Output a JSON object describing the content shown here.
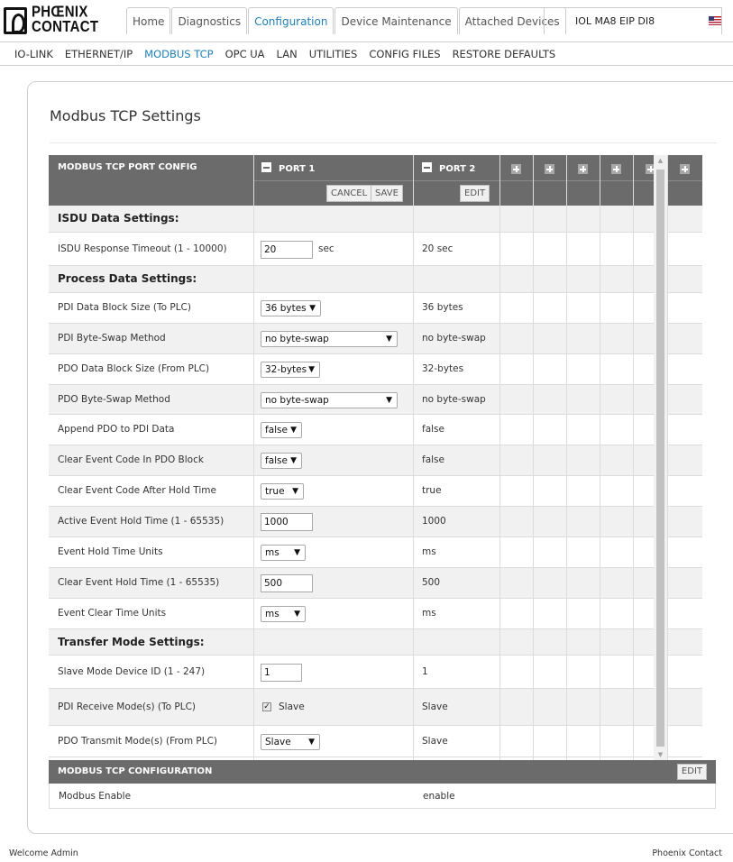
{
  "brand": {
    "line1": "PHŒNIX",
    "line2": "CONTACT"
  },
  "tabs": [
    {
      "label": "Home"
    },
    {
      "label": "Diagnostics"
    },
    {
      "label": "Configuration"
    },
    {
      "label": "Device Maintenance"
    },
    {
      "label": "Attached Devices"
    }
  ],
  "active_tab": "Configuration",
  "device_name": "IOL MA8 EIP DI8",
  "subnav": [
    "IO-LINK",
    "ETHERNET/IP",
    "MODBUS TCP",
    "OPC UA",
    "LAN",
    "UTILITIES",
    "CONFIG FILES",
    "RESTORE DEFAULTS"
  ],
  "active_subnav": "MODBUS TCP",
  "page_title": "Modbus TCP Settings",
  "port_table": {
    "header": "MODBUS TCP PORT CONFIG",
    "port1_label": "PORT 1",
    "port2_label": "PORT 2",
    "cancel_label": "CANCEL",
    "save_label": "SAVE",
    "edit_label": "EDIT",
    "rows": [
      {
        "type": "section",
        "label": "ISDU Data Settings:"
      },
      {
        "type": "input",
        "label": "ISDU Response Timeout (1 - 10000)",
        "port1": "20",
        "unit": "sec",
        "port2": "20 sec"
      },
      {
        "type": "section",
        "label": "Process Data Settings:"
      },
      {
        "type": "select",
        "label": "PDI Data Block Size (To PLC)",
        "port1": "36 bytes",
        "port2": "36 bytes"
      },
      {
        "type": "select",
        "label": "PDI Byte-Swap Method",
        "port1": "no byte-swap",
        "port2": "no byte-swap"
      },
      {
        "type": "select",
        "label": "PDO Data Block Size (From PLC)",
        "port1": "32-bytes",
        "port2": "32-bytes"
      },
      {
        "type": "select",
        "label": "PDO Byte-Swap Method",
        "port1": "no byte-swap",
        "port2": "no byte-swap"
      },
      {
        "type": "select",
        "label": "Append PDO to PDI Data",
        "port1": "false",
        "port2": "false"
      },
      {
        "type": "select",
        "label": "Clear Event Code In PDO Block",
        "port1": "false",
        "port2": "false"
      },
      {
        "type": "select",
        "label": "Clear Event Code After Hold Time",
        "port1": "true",
        "port2": "true"
      },
      {
        "type": "input",
        "label": "Active Event Hold Time (1 - 65535)",
        "port1": "1000",
        "port2": "1000"
      },
      {
        "type": "select",
        "label": "Event Hold Time Units",
        "port1": "ms",
        "port2": "ms"
      },
      {
        "type": "input",
        "label": "Clear Event Hold Time (1 - 65535)",
        "port1": "500",
        "port2": "500"
      },
      {
        "type": "select",
        "label": "Event Clear Time Units",
        "port1": "ms",
        "port2": "ms"
      },
      {
        "type": "section",
        "label": "Transfer Mode Settings:"
      },
      {
        "type": "input",
        "label": "Slave Mode Device ID (1 - 247)",
        "port1": "1",
        "port2": "1"
      },
      {
        "type": "checkbox",
        "label": "PDI Receive Mode(s) (To PLC)",
        "port1": "Slave",
        "checked": true,
        "port2": "Slave"
      },
      {
        "type": "select",
        "label": "PDO Transmit Mode(s) (From PLC)",
        "port1": "Slave",
        "port2": "Slave"
      }
    ]
  },
  "config_section": {
    "header": "MODBUS TCP CONFIGURATION",
    "edit_label": "EDIT",
    "row_label": "Modbus Enable",
    "row_value": "enable"
  },
  "footer": {
    "welcome": "Welcome Admin",
    "brand": "Phoenix Contact"
  },
  "colors": {
    "accent": "#1f7fb6",
    "header_bg": "#6b6b6b"
  }
}
